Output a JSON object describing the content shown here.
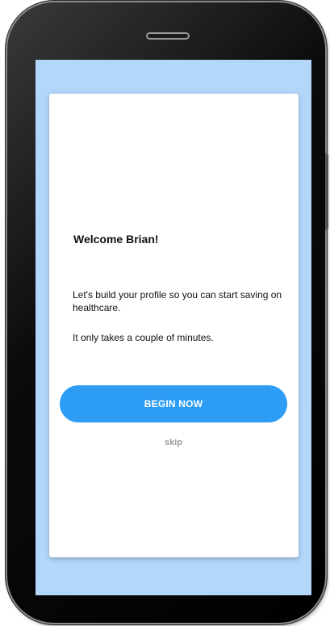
{
  "onboarding": {
    "title": "Welcome Brian!",
    "paragraph1": "Let's build your profile so you can start saving on healthcare.",
    "paragraph2": "It only takes a couple of minutes.",
    "begin_label": "BEGIN NOW",
    "skip_label": "skip"
  },
  "colors": {
    "accent": "#2d9cf5",
    "screen_background": "#b3d6fb",
    "card_background": "#ffffff",
    "skip_text": "#9a9a9a"
  }
}
